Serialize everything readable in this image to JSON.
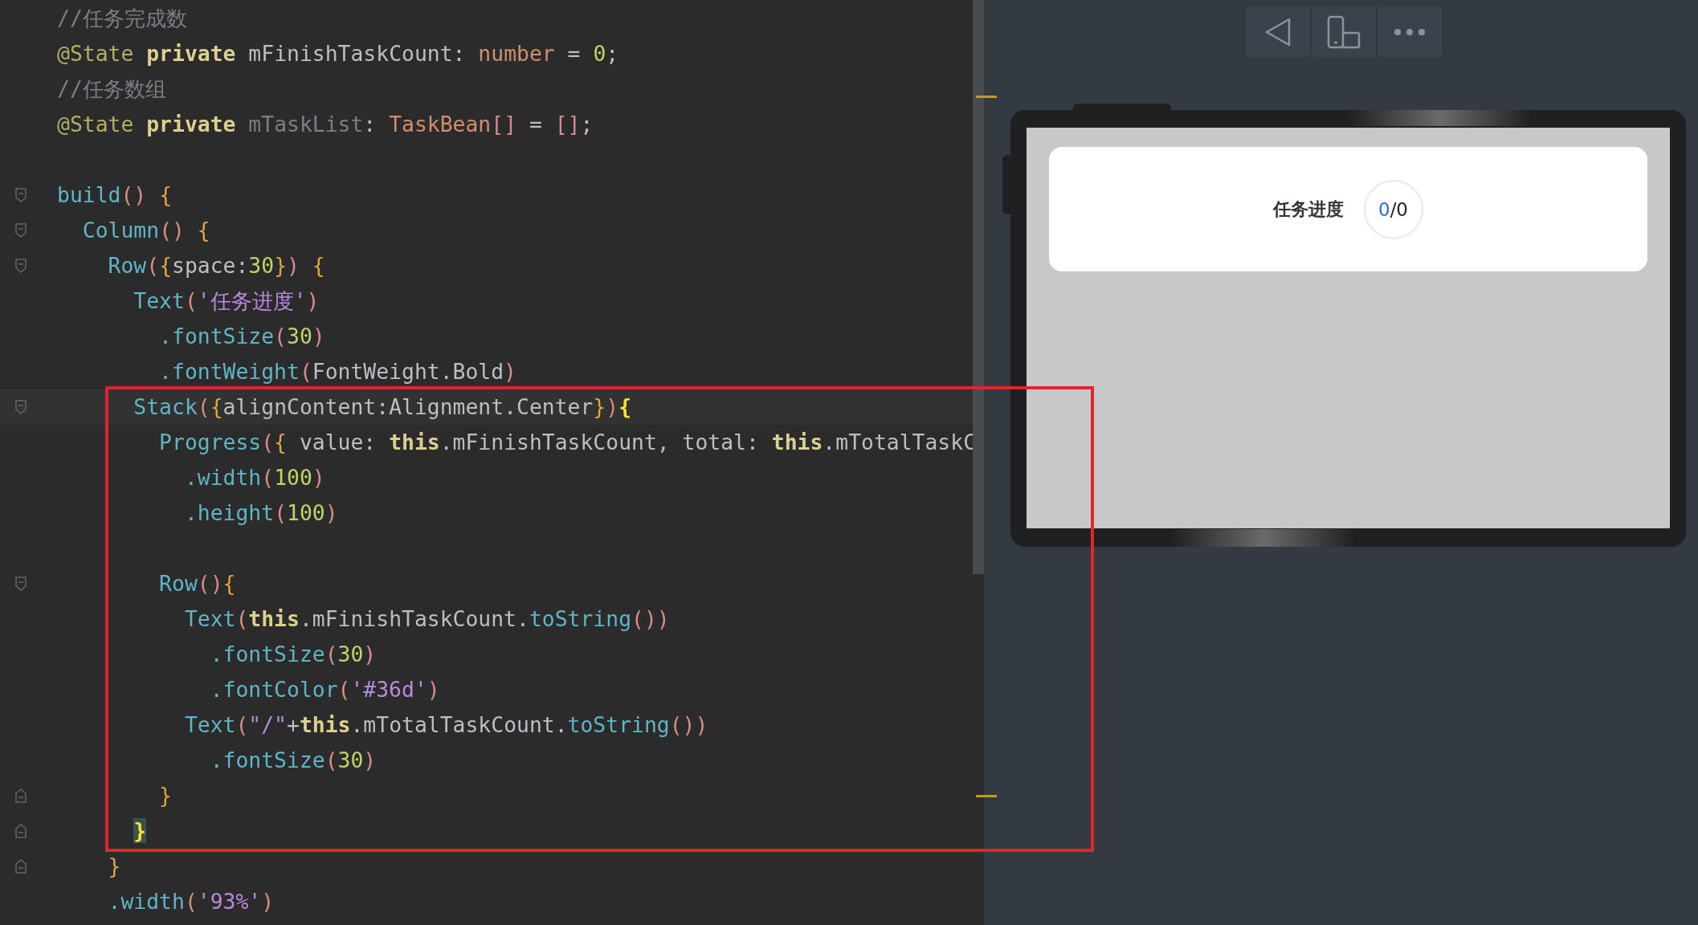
{
  "editor": {
    "lines": [
      {
        "kind": "code",
        "current": false,
        "fold_start": false,
        "fold_end": false,
        "tokens": [
          {
            "text": "//任务完成数",
            "kind": "comment"
          }
        ]
      },
      {
        "kind": "code",
        "current": false,
        "fold_start": false,
        "fold_end": false,
        "tokens": [
          {
            "text": "@State",
            "kind": "annotation"
          },
          {
            "text": " private",
            "kind": "keyword"
          },
          {
            "text": " mFinishTaskCount",
            "kind": "ident"
          },
          {
            "text": ": ",
            "kind": "op"
          },
          {
            "text": "number",
            "kind": "type"
          },
          {
            "text": " = ",
            "kind": "op"
          },
          {
            "text": "0",
            "kind": "number"
          },
          {
            "text": ";",
            "kind": "op"
          }
        ]
      },
      {
        "kind": "code",
        "current": false,
        "fold_start": false,
        "fold_end": false,
        "tokens": [
          {
            "text": "//任务数组",
            "kind": "comment"
          }
        ]
      },
      {
        "kind": "code",
        "current": false,
        "fold_start": false,
        "fold_end": false,
        "tokens": [
          {
            "text": "@State",
            "kind": "annotation"
          },
          {
            "text": " private",
            "kind": "keyword"
          },
          {
            "text": " mTaskList",
            "kind": "unused"
          },
          {
            "text": ": ",
            "kind": "op"
          },
          {
            "text": "TaskBean",
            "kind": "type"
          },
          {
            "text": "[]",
            "kind": "paren"
          },
          {
            "text": " = ",
            "kind": "op"
          },
          {
            "text": "[]",
            "kind": "paren"
          },
          {
            "text": ";",
            "kind": "op"
          }
        ]
      },
      {
        "kind": "blank"
      },
      {
        "kind": "code",
        "current": false,
        "fold_start": true,
        "fold_end": false,
        "tokens": [
          {
            "text": "build",
            "kind": "func"
          },
          {
            "text": "() ",
            "kind": "paren"
          },
          {
            "text": "{",
            "kind": "brace"
          }
        ]
      },
      {
        "kind": "code",
        "current": false,
        "fold_start": true,
        "fold_end": false,
        "tokens": [
          {
            "text": "  Column",
            "kind": "func"
          },
          {
            "text": "() ",
            "kind": "paren"
          },
          {
            "text": "{",
            "kind": "brace"
          }
        ]
      },
      {
        "kind": "code",
        "current": false,
        "fold_start": true,
        "fold_end": false,
        "tokens": [
          {
            "text": "    Row",
            "kind": "func"
          },
          {
            "text": "(",
            "kind": "paren"
          },
          {
            "text": "{",
            "kind": "brace"
          },
          {
            "text": "space:",
            "kind": "ident"
          },
          {
            "text": "30",
            "kind": "number"
          },
          {
            "text": "}",
            "kind": "brace"
          },
          {
            "text": ") ",
            "kind": "paren"
          },
          {
            "text": "{",
            "kind": "brace"
          }
        ]
      },
      {
        "kind": "code",
        "current": false,
        "fold_start": false,
        "fold_end": false,
        "tokens": [
          {
            "text": "      Text",
            "kind": "func"
          },
          {
            "text": "(",
            "kind": "paren"
          },
          {
            "text": "'任务进度'",
            "kind": "string"
          },
          {
            "text": ")",
            "kind": "paren"
          }
        ]
      },
      {
        "kind": "code",
        "current": false,
        "fold_start": false,
        "fold_end": false,
        "tokens": [
          {
            "text": "        .fontSize",
            "kind": "func"
          },
          {
            "text": "(",
            "kind": "paren"
          },
          {
            "text": "30",
            "kind": "number"
          },
          {
            "text": ")",
            "kind": "paren"
          }
        ]
      },
      {
        "kind": "code",
        "current": false,
        "fold_start": false,
        "fold_end": false,
        "tokens": [
          {
            "text": "        .fontWeight",
            "kind": "func"
          },
          {
            "text": "(",
            "kind": "paren"
          },
          {
            "text": "FontWeight.Bold",
            "kind": "ident"
          },
          {
            "text": ")",
            "kind": "paren"
          }
        ]
      },
      {
        "kind": "code",
        "current": true,
        "fold_start": true,
        "fold_end": false,
        "tokens": [
          {
            "text": "      Stack",
            "kind": "func"
          },
          {
            "text": "(",
            "kind": "paren"
          },
          {
            "text": "{",
            "kind": "brace"
          },
          {
            "text": "alignContent:Alignment.Center",
            "kind": "ident"
          },
          {
            "text": "}",
            "kind": "brace"
          },
          {
            "text": ")",
            "kind": "paren"
          },
          {
            "text": "{",
            "kind": "match"
          }
        ]
      },
      {
        "kind": "code",
        "current": false,
        "fold_start": false,
        "fold_end": false,
        "tokens": [
          {
            "text": "        Progress",
            "kind": "func"
          },
          {
            "text": "(",
            "kind": "paren"
          },
          {
            "text": "{",
            "kind": "brace"
          },
          {
            "text": " value: ",
            "kind": "ident"
          },
          {
            "text": "this",
            "kind": "keyword"
          },
          {
            "text": ".mFinishTaskCount, total: ",
            "kind": "ident"
          },
          {
            "text": "this",
            "kind": "keyword"
          },
          {
            "text": ".mTotalTaskC",
            "kind": "ident"
          }
        ]
      },
      {
        "kind": "code",
        "current": false,
        "fold_start": false,
        "fold_end": false,
        "tokens": [
          {
            "text": "          .width",
            "kind": "func"
          },
          {
            "text": "(",
            "kind": "paren"
          },
          {
            "text": "100",
            "kind": "number"
          },
          {
            "text": ")",
            "kind": "paren"
          }
        ]
      },
      {
        "kind": "code",
        "current": false,
        "fold_start": false,
        "fold_end": false,
        "tokens": [
          {
            "text": "          .height",
            "kind": "func"
          },
          {
            "text": "(",
            "kind": "paren"
          },
          {
            "text": "100",
            "kind": "number"
          },
          {
            "text": ")",
            "kind": "paren"
          }
        ]
      },
      {
        "kind": "blank"
      },
      {
        "kind": "code",
        "current": false,
        "fold_start": true,
        "fold_end": false,
        "tokens": [
          {
            "text": "        Row",
            "kind": "func"
          },
          {
            "text": "()",
            "kind": "paren"
          },
          {
            "text": "{",
            "kind": "brace"
          }
        ]
      },
      {
        "kind": "code",
        "current": false,
        "fold_start": false,
        "fold_end": false,
        "tokens": [
          {
            "text": "          Text",
            "kind": "func"
          },
          {
            "text": "(",
            "kind": "paren"
          },
          {
            "text": "this",
            "kind": "keyword"
          },
          {
            "text": ".mFinishTaskCount.",
            "kind": "ident"
          },
          {
            "text": "toString",
            "kind": "func"
          },
          {
            "text": "())",
            "kind": "paren"
          }
        ]
      },
      {
        "kind": "code",
        "current": false,
        "fold_start": false,
        "fold_end": false,
        "tokens": [
          {
            "text": "            .fontSize",
            "kind": "func"
          },
          {
            "text": "(",
            "kind": "paren"
          },
          {
            "text": "30",
            "kind": "number"
          },
          {
            "text": ")",
            "kind": "paren"
          }
        ]
      },
      {
        "kind": "code",
        "current": false,
        "fold_start": false,
        "fold_end": false,
        "tokens": [
          {
            "text": "            .fontColor",
            "kind": "func"
          },
          {
            "text": "(",
            "kind": "paren"
          },
          {
            "text": "'#36d'",
            "kind": "string"
          },
          {
            "text": ")",
            "kind": "paren"
          }
        ]
      },
      {
        "kind": "code",
        "current": false,
        "fold_start": false,
        "fold_end": false,
        "tokens": [
          {
            "text": "          Text",
            "kind": "func"
          },
          {
            "text": "(",
            "kind": "paren"
          },
          {
            "text": "\"/\"",
            "kind": "string"
          },
          {
            "text": "+",
            "kind": "op"
          },
          {
            "text": "this",
            "kind": "keyword"
          },
          {
            "text": ".mTotalTaskCount.",
            "kind": "ident"
          },
          {
            "text": "toString",
            "kind": "func"
          },
          {
            "text": "())",
            "kind": "paren"
          }
        ]
      },
      {
        "kind": "code",
        "current": false,
        "fold_start": false,
        "fold_end": false,
        "tokens": [
          {
            "text": "            .fontSize",
            "kind": "func"
          },
          {
            "text": "(",
            "kind": "paren"
          },
          {
            "text": "30",
            "kind": "number"
          },
          {
            "text": ")",
            "kind": "paren"
          }
        ]
      },
      {
        "kind": "code",
        "current": false,
        "fold_start": false,
        "fold_end": true,
        "tokens": [
          {
            "text": "        }",
            "kind": "brace"
          }
        ]
      },
      {
        "kind": "code",
        "current": false,
        "fold_start": false,
        "fold_end": true,
        "tokens": [
          {
            "text": "      }",
            "kind": "matchbox"
          }
        ]
      },
      {
        "kind": "code",
        "current": false,
        "fold_start": false,
        "fold_end": true,
        "tokens": [
          {
            "text": "    }",
            "kind": "brace"
          }
        ]
      },
      {
        "kind": "code",
        "current": false,
        "fold_start": false,
        "fold_end": false,
        "tokens": [
          {
            "text": "    .width",
            "kind": "func"
          },
          {
            "text": "(",
            "kind": "paren"
          },
          {
            "text": "'93%'",
            "kind": "string"
          },
          {
            "text": ")",
            "kind": "paren"
          }
        ]
      }
    ]
  },
  "preview": {
    "card": {
      "title": "任务进度",
      "progress": {
        "finished": "0",
        "total": "/0"
      }
    }
  }
}
